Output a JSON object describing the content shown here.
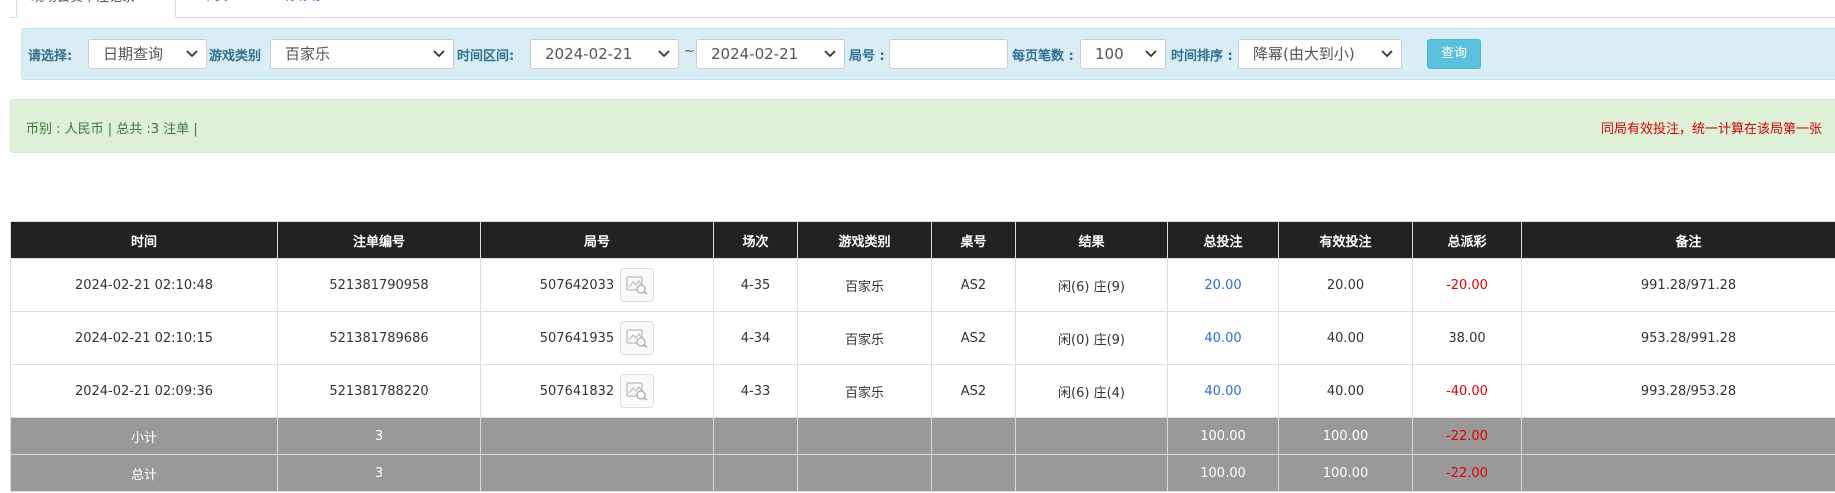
{
  "tabs": [
    {
      "label": "现场会员下注记录"
    },
    {
      "label": "BB下费"
    },
    {
      "label": "BB现场助"
    }
  ],
  "filter": {
    "select_label": "请选择:",
    "query_mode": "日期查询",
    "game_type_label": "游戏类别",
    "game_type": "百家乐",
    "time_range_label": "时间区间:",
    "date_from": "2024-02-21",
    "range_sep": "~",
    "date_to": "2024-02-21",
    "round_label": "局号 :",
    "round_value": "",
    "page_size_label": "每页笔数 :",
    "page_size": "100",
    "sort_label": "时间排序 :",
    "sort": "降幂(由大到小)",
    "query_button": "查询"
  },
  "info": {
    "summary": "币别 : 人民币 | 总共 :3 注单 |",
    "notice": "同局有效投注，统一计算在该局第一张"
  },
  "table": {
    "headers": [
      "时间",
      "注单编号",
      "局号",
      "场次",
      "游戏类别",
      "桌号",
      "结果",
      "总投注",
      "有效投注",
      "总派彩",
      "备注"
    ],
    "rows": [
      {
        "time": "2024-02-21 02:10:48",
        "bet_id": "521381790958",
        "round": "507642033",
        "session": "4-35",
        "game": "百家乐",
        "table": "AS2",
        "result": "闲(6) 庄(9)",
        "total_bet": "20.00",
        "valid_bet": "20.00",
        "payout": "-20.00",
        "note": "991.28/971.28"
      },
      {
        "time": "2024-02-21 02:10:15",
        "bet_id": "521381789686",
        "round": "507641935",
        "session": "4-34",
        "game": "百家乐",
        "table": "AS2",
        "result": "闲(0) 庄(9)",
        "total_bet": "40.00",
        "valid_bet": "40.00",
        "payout": "38.00",
        "note": "953.28/991.28"
      },
      {
        "time": "2024-02-21 02:09:36",
        "bet_id": "521381788220",
        "round": "507641832",
        "session": "4-33",
        "game": "百家乐",
        "table": "AS2",
        "result": "闲(6) 庄(4)",
        "total_bet": "40.00",
        "valid_bet": "40.00",
        "payout": "-40.00",
        "note": "993.28/953.28"
      }
    ],
    "subtotal": {
      "label": "小计",
      "count": "3",
      "total_bet": "100.00",
      "valid_bet": "100.00",
      "payout": "-22.00"
    },
    "total": {
      "label": "总计",
      "count": "3",
      "total_bet": "100.00",
      "valid_bet": "100.00",
      "payout": "-22.00"
    }
  },
  "icons": {
    "round_detail": "image-search-icon"
  },
  "colors": {
    "header_bg": "#222222",
    "info_red": "#d60000",
    "negative": "#e60000",
    "bet_blue": "#2e6ed8",
    "sum_bg": "#999999",
    "filter_bg": "#d9edf7",
    "info_bg": "#dff0d8",
    "query_btn": "#5bc0de"
  }
}
